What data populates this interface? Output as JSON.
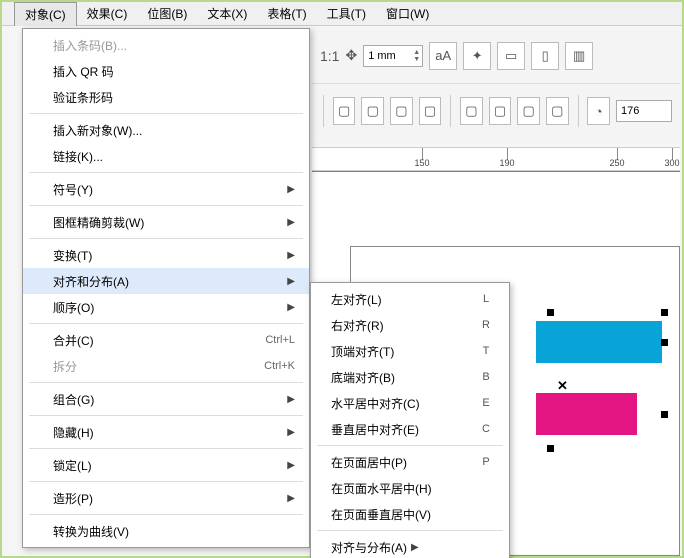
{
  "menubar": {
    "items": [
      {
        "label": "对象(C)",
        "active": true
      },
      {
        "label": "效果(C)"
      },
      {
        "label": "位图(B)"
      },
      {
        "label": "文本(X)"
      },
      {
        "label": "表格(T)"
      },
      {
        "label": "工具(T)"
      },
      {
        "label": "窗口(W)"
      }
    ]
  },
  "dropdown": {
    "items": [
      {
        "label": "插入条码(B)...",
        "disabled": true
      },
      {
        "label": "插入 QR 码"
      },
      {
        "label": "验证条形码"
      },
      {
        "sep": true
      },
      {
        "label": "插入新对象(W)..."
      },
      {
        "label": "链接(K)..."
      },
      {
        "sep": true
      },
      {
        "label": "符号(Y)",
        "submenu": true
      },
      {
        "sep": true
      },
      {
        "label": "图框精确剪裁(W)",
        "submenu": true
      },
      {
        "sep": true
      },
      {
        "label": "变换(T)",
        "submenu": true
      },
      {
        "label": "对齐和分布(A)",
        "submenu": true,
        "highlight": true
      },
      {
        "label": "顺序(O)",
        "submenu": true
      },
      {
        "sep": true
      },
      {
        "label": "合并(C)",
        "shortcut": "Ctrl+L"
      },
      {
        "label": "拆分",
        "shortcut": "Ctrl+K",
        "disabled": true
      },
      {
        "sep": true
      },
      {
        "label": "组合(G)",
        "submenu": true
      },
      {
        "sep": true
      },
      {
        "label": "隐藏(H)",
        "submenu": true
      },
      {
        "sep": true
      },
      {
        "label": "锁定(L)",
        "submenu": true
      },
      {
        "sep": true
      },
      {
        "label": "造形(P)",
        "submenu": true
      },
      {
        "sep": true
      },
      {
        "label": "转换为曲线(V)"
      }
    ]
  },
  "submenu": {
    "items": [
      {
        "label": "左对齐(L)",
        "key": "L"
      },
      {
        "label": "右对齐(R)",
        "key": "R"
      },
      {
        "label": "顶端对齐(T)",
        "key": "T"
      },
      {
        "label": "底端对齐(B)",
        "key": "B"
      },
      {
        "label": "水平居中对齐(C)",
        "key": "E"
      },
      {
        "label": "垂直居中对齐(E)",
        "key": "C"
      },
      {
        "sep": true
      },
      {
        "label": "在页面居中(P)",
        "key": "P"
      },
      {
        "label": "在页面水平居中(H)"
      },
      {
        "label": "在页面垂直居中(V)"
      },
      {
        "sep": true
      },
      {
        "label": "对齐与分布(A)",
        "arrow": true
      }
    ]
  },
  "toolbar": {
    "ratio_label": "1:1",
    "unit_value": "1 mm",
    "num_value": "176"
  },
  "ruler": {
    "marks": [
      {
        "pos": 110,
        "label": "150"
      },
      {
        "pos": 195,
        "label": "190"
      },
      {
        "pos": 305,
        "label": "250"
      },
      {
        "pos": 360,
        "label": "300"
      }
    ]
  }
}
